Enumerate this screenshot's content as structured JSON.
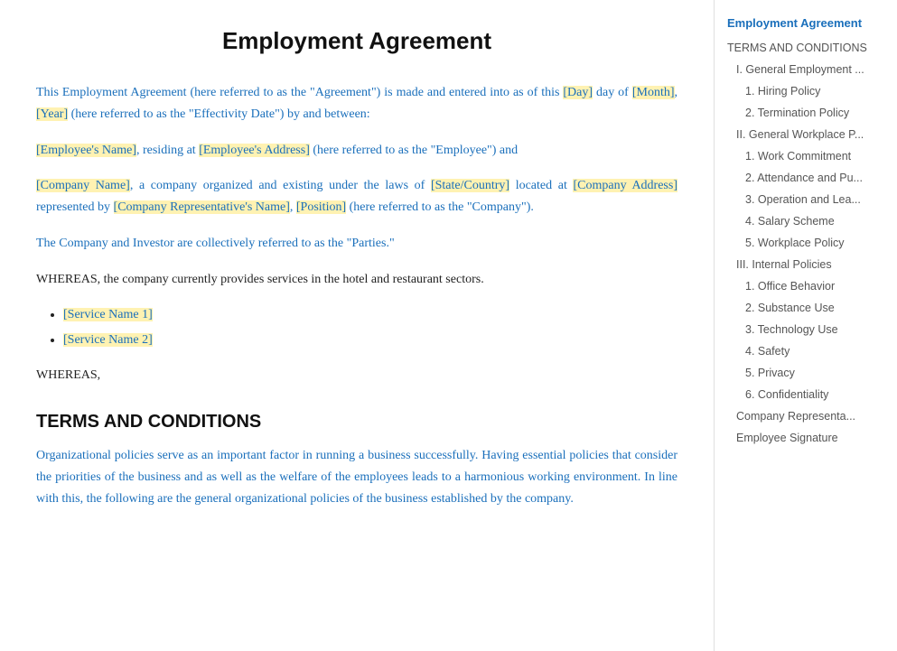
{
  "document": {
    "title": "Employment Agreement",
    "intro_paragraph_1": "This Employment Agreement (here referred to as the \"Agreement\") is made and entered into as of this ",
    "intro_day": "[Day]",
    "intro_mid1": " day of ",
    "intro_month": "[Month]",
    "intro_comma": ", ",
    "intro_year": "[Year]",
    "intro_rest1": " (here referred to as the \"Effectivity Date\") by and between:",
    "intro_paragraph_2_start": "",
    "employee_name": "[Employee's Name]",
    "intro_p2_mid": ", residing at ",
    "employee_address": "[Employee's Address]",
    "intro_p2_end": " (here referred to as the \"Employee\") and",
    "company_name": "[Company Name]",
    "intro_p3_mid": ", a company organized and existing under the laws of ",
    "state_country": "[State/Country]",
    "intro_p3_mid2": " located at ",
    "company_address": "[Company Address]",
    "intro_p3_mid3": " represented by ",
    "company_rep": "[Company Representative's Name]",
    "intro_p3_mid4": ", ",
    "position": "[Position]",
    "intro_p3_end": " (here referred to as the \"Company\").",
    "parties_text": "The Company and Investor are collectively referred to as the \"Parties.\"",
    "whereas_text": "WHEREAS, the company currently provides services in the hotel and restaurant sectors.",
    "service1": "[Service Name 1]",
    "service2": "[Service Name 2]",
    "whereas2": "WHEREAS,",
    "terms_heading": "TERMS AND CONDITIONS",
    "terms_intro": "Organizational policies serve as an important factor in running a business successfully. Having essential policies that consider the priorities of the business and as well as the welfare of the employees leads to a harmonious working environment. In line with this, the following are the general organizational policies of the business established by the company."
  },
  "toc": {
    "title": "Employment Agreement",
    "items": [
      {
        "label": "TERMS AND CONDITIONS",
        "level": "section"
      },
      {
        "label": "I. General Employment ...",
        "level": "item"
      },
      {
        "label": "1. Hiring Policy",
        "level": "sub"
      },
      {
        "label": "2. Termination Policy",
        "level": "sub"
      },
      {
        "label": "II. General Workplace P...",
        "level": "item"
      },
      {
        "label": "1. Work Commitment",
        "level": "sub"
      },
      {
        "label": "2. Attendance and Pu...",
        "level": "sub"
      },
      {
        "label": "3.  Operation and Lea...",
        "level": "sub"
      },
      {
        "label": "4. Salary Scheme",
        "level": "sub"
      },
      {
        "label": "5.  Workplace Policy",
        "level": "sub"
      },
      {
        "label": "III. Internal Policies",
        "level": "item"
      },
      {
        "label": "1. Office Behavior",
        "level": "sub"
      },
      {
        "label": "2. Substance Use",
        "level": "sub"
      },
      {
        "label": "3. Technology Use",
        "level": "sub"
      },
      {
        "label": "4. Safety",
        "level": "sub"
      },
      {
        "label": "5. Privacy",
        "level": "sub"
      },
      {
        "label": "6. Confidentiality",
        "level": "sub"
      },
      {
        "label": "Company Representa...",
        "level": "item"
      },
      {
        "label": "Employee Signature",
        "level": "item"
      }
    ]
  }
}
